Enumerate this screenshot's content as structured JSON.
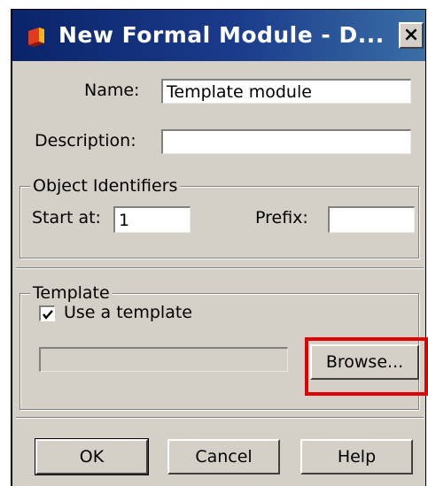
{
  "dialog": {
    "title": "New Formal Module - D...",
    "close_label": "×"
  },
  "form": {
    "name_label": "Name:",
    "name_value": "Template module",
    "description_label": "Description:",
    "description_value": ""
  },
  "object_identifiers": {
    "legend": "Object Identifiers",
    "start_label": "Start at:",
    "start_value": "1",
    "prefix_label": "Prefix:",
    "prefix_value": ""
  },
  "template": {
    "legend": "Template",
    "checkbox_label": "Use a template",
    "checked": true,
    "path_value": "",
    "browse_label": "Browse..."
  },
  "buttons": {
    "ok": "OK",
    "cancel": "Cancel",
    "help": "Help"
  },
  "highlight_color": "#e00000"
}
